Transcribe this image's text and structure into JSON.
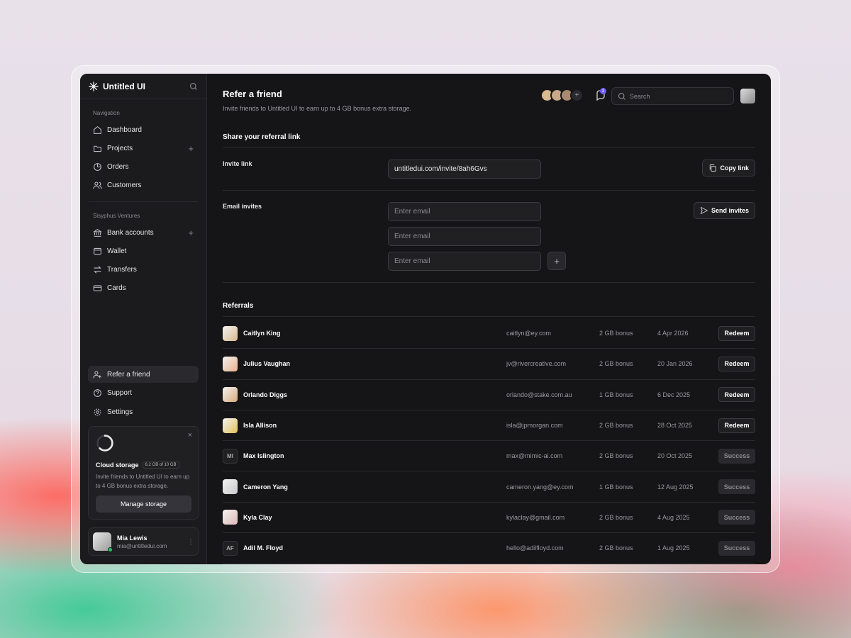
{
  "brand": {
    "name": "Untitled UI"
  },
  "sidebar": {
    "nav_label": "Navigation",
    "nav": [
      {
        "label": "Dashboard",
        "icon": "home-icon"
      },
      {
        "label": "Projects",
        "icon": "folder-icon",
        "plus": "+"
      },
      {
        "label": "Orders",
        "icon": "pie-chart-icon"
      },
      {
        "label": "Customers",
        "icon": "users-icon"
      }
    ],
    "org_label": "Sisyphus Ventures",
    "org": [
      {
        "label": "Bank accounts",
        "icon": "bank-icon",
        "plus": "+"
      },
      {
        "label": "Wallet",
        "icon": "wallet-icon"
      },
      {
        "label": "Transfers",
        "icon": "transfer-icon"
      },
      {
        "label": "Cards",
        "icon": "credit-card-icon"
      }
    ],
    "bottom": [
      {
        "label": "Refer a friend",
        "icon": "user-plus-icon",
        "active": true
      },
      {
        "label": "Support",
        "icon": "help-circle-icon"
      },
      {
        "label": "Settings",
        "icon": "gear-icon"
      }
    ],
    "storage": {
      "title": "Cloud storage",
      "badge": "6.2 GB of 10 GB",
      "used_fraction": 0.62,
      "desc": "Invite friends to Untitled UI to earn up to 4 GB bonus extra storage.",
      "button": "Manage storage",
      "close": "×"
    },
    "profile": {
      "name": "Mia Lewis",
      "email": "mia@untitledui.com",
      "menu": "⋮"
    }
  },
  "header": {
    "title": "Refer a friend",
    "subtitle": "Invite friends to Untitled UI to earn up to 4 GB bonus extra storage.",
    "notification_count": "2",
    "search_placeholder": "Search",
    "avatars_plus": "+"
  },
  "share": {
    "title": "Share your referral link",
    "invite_label": "Invite link",
    "invite_url": "untitledui.com/invite/8ah6Gvs",
    "copy_button": "Copy link",
    "email_label": "Email invites",
    "email_placeholder": "Enter email",
    "send_button": "Send invites",
    "add": "+"
  },
  "referrals": {
    "title": "Referrals",
    "rows": [
      {
        "name": "Caitlyn King",
        "email": "caitlyn@ey.com",
        "bonus": "2 GB bonus",
        "date": "4 Apr 2026",
        "action": "Redeem",
        "status": "redeem",
        "avatar": "#d9b98f"
      },
      {
        "name": "Julius Vaughan",
        "email": "jv@rivercreative.com",
        "bonus": "2 GB bonus",
        "date": "20 Jan 2026",
        "action": "Redeem",
        "status": "redeem",
        "avatar": "#e8b08a"
      },
      {
        "name": "Orlando Diggs",
        "email": "orlando@stake.com.au",
        "bonus": "1 GB bonus",
        "date": "6 Dec 2025",
        "action": "Redeem",
        "status": "redeem",
        "avatar": "#d7a97a"
      },
      {
        "name": "Isla Allison",
        "email": "isla@jpmorgan.com",
        "bonus": "2 GB bonus",
        "date": "28 Oct 2025",
        "action": "Redeem",
        "status": "redeem",
        "avatar": "#e3c05a"
      },
      {
        "name": "Max Islington",
        "email": "max@mimic-ai.com",
        "bonus": "2 GB bonus",
        "date": "20 Oct 2025",
        "action": "Success",
        "status": "success",
        "initials": "MI"
      },
      {
        "name": "Cameron Yang",
        "email": "cameron.yang@ey.com",
        "bonus": "1 GB bonus",
        "date": "12 Aug 2025",
        "action": "Success",
        "status": "success",
        "avatar": "#c9c9c9"
      },
      {
        "name": "Kyla Clay",
        "email": "kylaclay@gmail.com",
        "bonus": "2 GB bonus",
        "date": "4 Aug 2025",
        "action": "Success",
        "status": "success",
        "avatar": "#e0b8b8"
      },
      {
        "name": "Adil M. Floyd",
        "email": "hello@adilfloyd.com",
        "bonus": "2 GB bonus",
        "date": "1 Aug 2025",
        "action": "Success",
        "status": "success",
        "initials": "AF"
      }
    ]
  }
}
